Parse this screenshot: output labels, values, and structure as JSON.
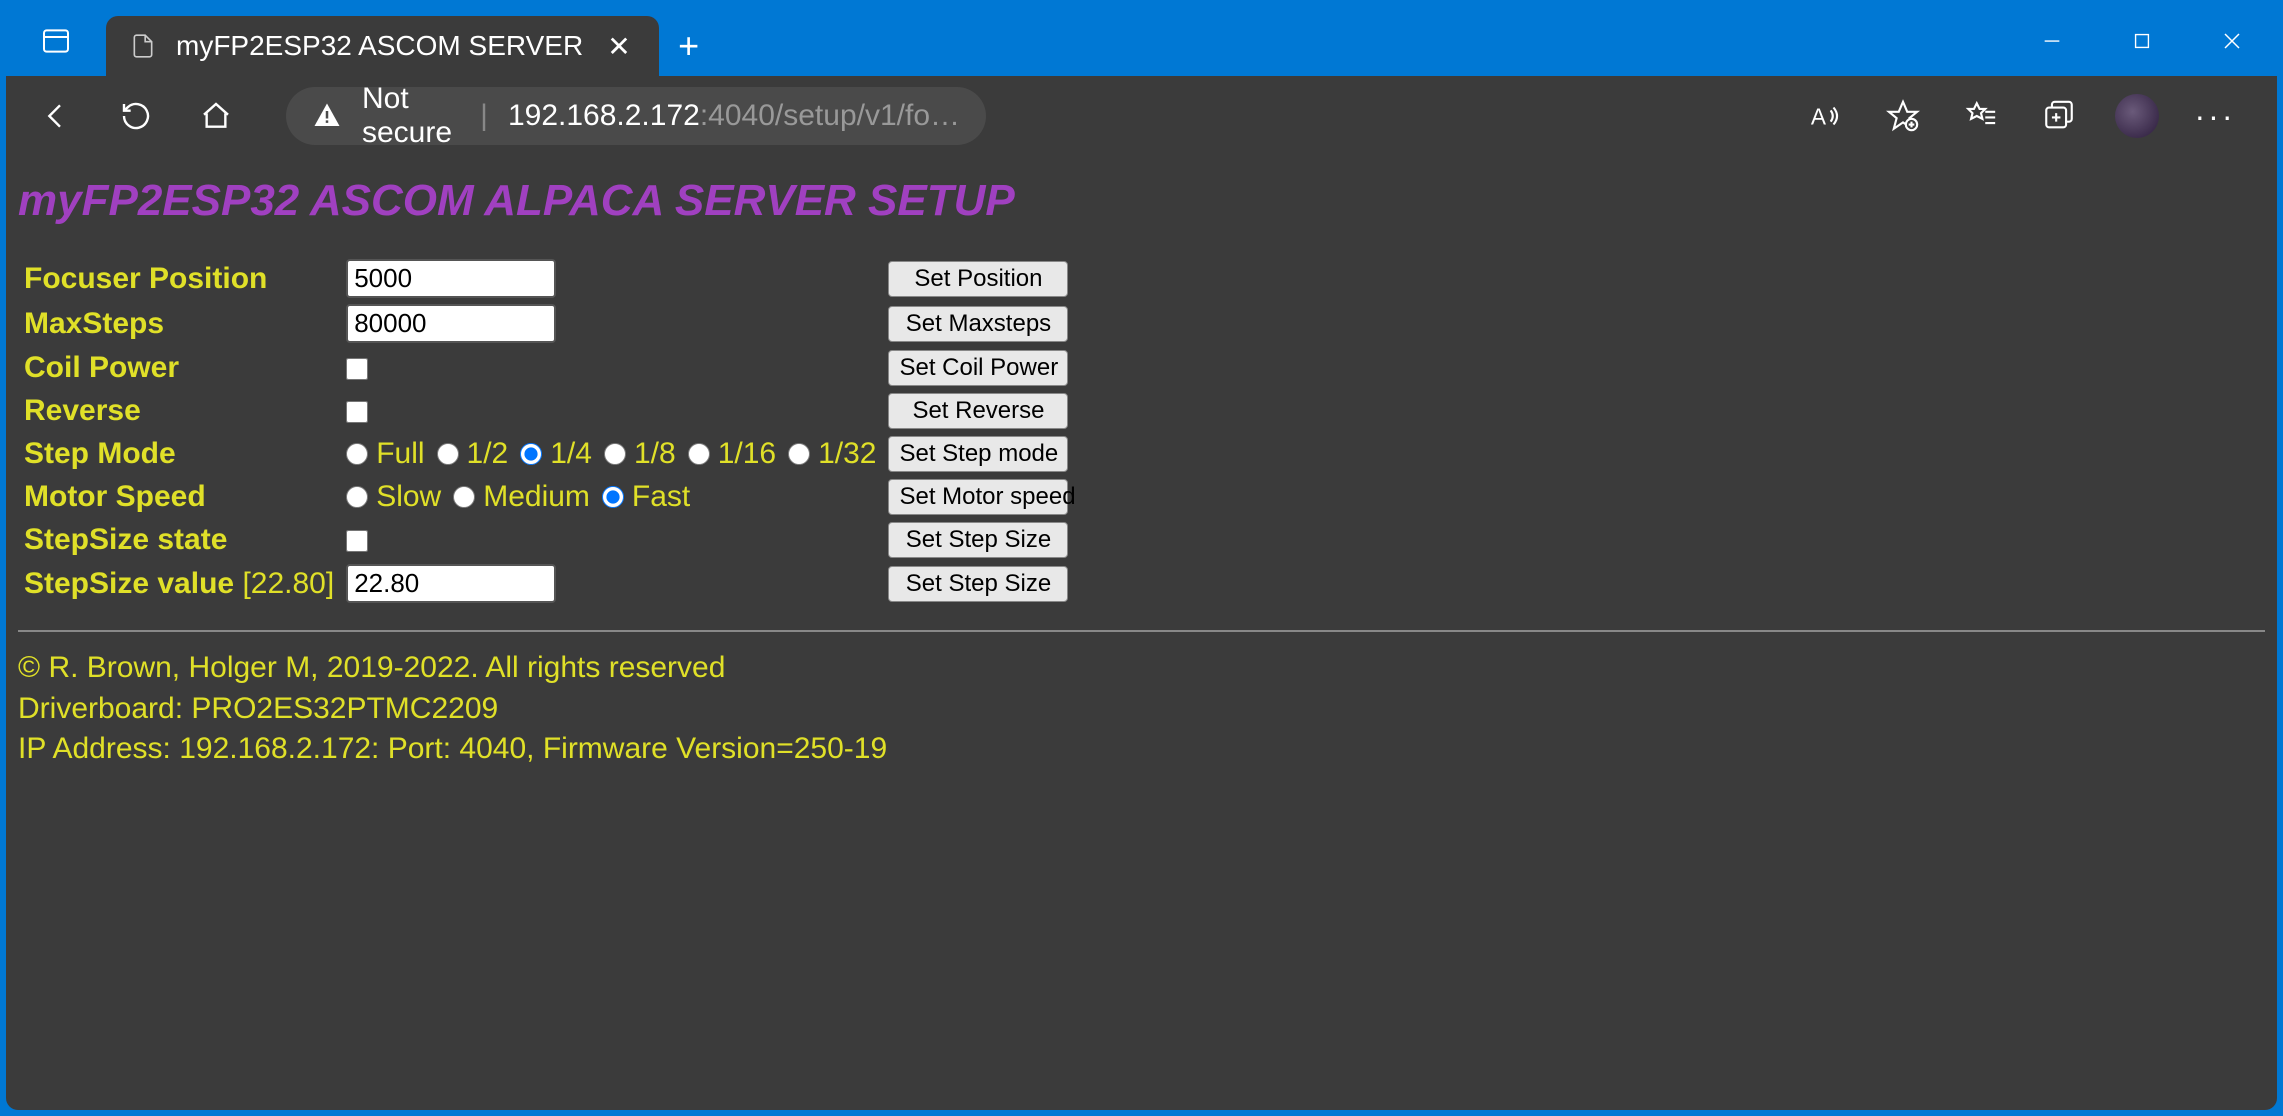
{
  "browser": {
    "tab_title": "myFP2ESP32 ASCOM SERVER",
    "not_secure_label": "Not secure",
    "url_host": "192.168.2.172",
    "url_path": ":4040/setup/v1/fo…"
  },
  "page": {
    "title": "myFP2ESP32 ASCOM ALPACA SERVER SETUP"
  },
  "form": {
    "focuser_position": {
      "label": "Focuser Position",
      "value": "5000",
      "button": "Set Position"
    },
    "max_steps": {
      "label": "MaxSteps",
      "value": "80000",
      "button": "Set Maxsteps"
    },
    "coil_power": {
      "label": "Coil Power",
      "checked": false,
      "button": "Set Coil Power"
    },
    "reverse": {
      "label": "Reverse",
      "checked": false,
      "button": "Set Reverse"
    },
    "step_mode": {
      "label": "Step Mode",
      "options": [
        "Full",
        "1/2",
        "1/4",
        "1/8",
        "1/16",
        "1/32"
      ],
      "selected": "1/4",
      "button": "Set Step mode"
    },
    "motor_speed": {
      "label": "Motor Speed",
      "options": [
        "Slow",
        "Medium",
        "Fast"
      ],
      "selected": "Fast",
      "button": "Set Motor speed"
    },
    "stepsize_state": {
      "label": "StepSize state",
      "checked": false,
      "button": "Set Step Size"
    },
    "stepsize_value": {
      "label": "StepSize value",
      "current": "[22.80]",
      "value": "22.80",
      "button": "Set Step Size"
    }
  },
  "footer": {
    "copyright": "© R. Brown, Holger M, 2019-2022. All rights reserved",
    "driverboard": "Driverboard: PRO2ES32PTMC2209",
    "ip": "IP Address: 192.168.2.172: Port: 4040, Firmware Version=250-19"
  }
}
